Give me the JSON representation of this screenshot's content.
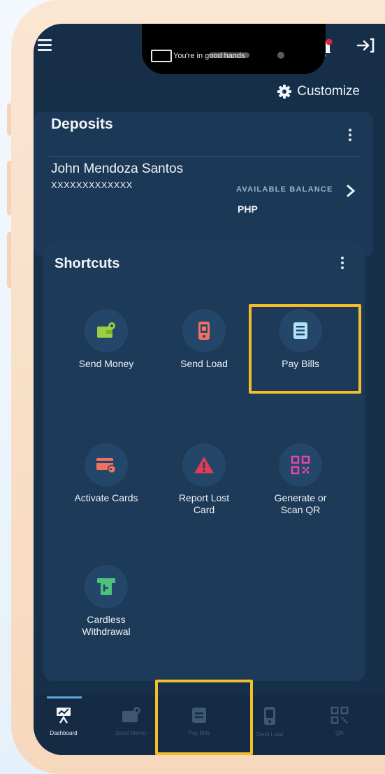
{
  "header": {
    "tagline": "You're in good hands"
  },
  "toolbar": {
    "customize_label": "Customize"
  },
  "deposits": {
    "title": "Deposits",
    "account_name": "John Mendoza Santos",
    "account_number": "XXXXXXXXXXXXX",
    "balance_label": "AVAILABLE BALANCE",
    "currency": "PHP"
  },
  "shortcuts": {
    "title": "Shortcuts",
    "items": [
      {
        "label": "Send Money",
        "icon": "wallet-icon"
      },
      {
        "label": "Send Load",
        "icon": "phone-load-icon"
      },
      {
        "label": "Pay Bills",
        "icon": "bill-icon"
      },
      {
        "label": "Activate Cards",
        "icon": "card-icon"
      },
      {
        "label": "Report Lost Card",
        "icon": "warning-icon"
      },
      {
        "label": "Generate or Scan QR",
        "icon": "qr-icon"
      },
      {
        "label": "Cardless Withdrawal",
        "icon": "atm-icon"
      }
    ]
  },
  "bottom_nav": {
    "items": [
      {
        "label": "Dashboard",
        "icon": "dashboard-icon",
        "active": true
      },
      {
        "label": "Send Money",
        "icon": "wallet-icon"
      },
      {
        "label": "Pay Bills",
        "icon": "bill-icon"
      },
      {
        "label": "Send Load",
        "icon": "phone-load-icon"
      },
      {
        "label": "QR",
        "icon": "qr-icon"
      }
    ]
  },
  "colors": {
    "screen_bg": "#16304a",
    "card_bg": "#1d3a58",
    "icon_circle": "#244668",
    "highlight": "#f4bd2a",
    "phone_frame": "#f6d8bd"
  }
}
